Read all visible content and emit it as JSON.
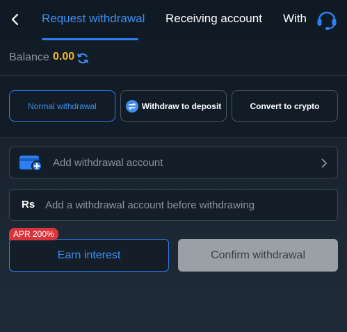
{
  "header": {
    "tabs": [
      {
        "label": "Request withdrawal",
        "active": true
      },
      {
        "label": "Receiving account",
        "active": false
      },
      {
        "label": "With",
        "active": false
      }
    ],
    "icons": {
      "back": "chevron-left-icon",
      "support": "headset-icon"
    }
  },
  "balance": {
    "label": "Balance",
    "value": "0.00",
    "icon": "refresh-icon"
  },
  "methods": [
    {
      "label": "Normal withdrawal",
      "active": true
    },
    {
      "label": "Withdraw to deposit",
      "active": false,
      "icon": "transfer-icon"
    },
    {
      "label": "Convert to crypto",
      "active": false
    }
  ],
  "account_field": {
    "placeholder": "Add withdrawal account",
    "icon": "card-add-icon"
  },
  "amount_field": {
    "currency_symbol": "Rs",
    "placeholder": "Add a withdrawal account before withdrawing"
  },
  "earn": {
    "badge": "APR 200%",
    "label": "Earn interest"
  },
  "confirm": {
    "label": "Confirm withdrawal"
  },
  "colors": {
    "accent": "#2d7ef0",
    "balance": "#f5b62a",
    "badge": "#d8353b",
    "disabled": "#9aa0a6"
  }
}
